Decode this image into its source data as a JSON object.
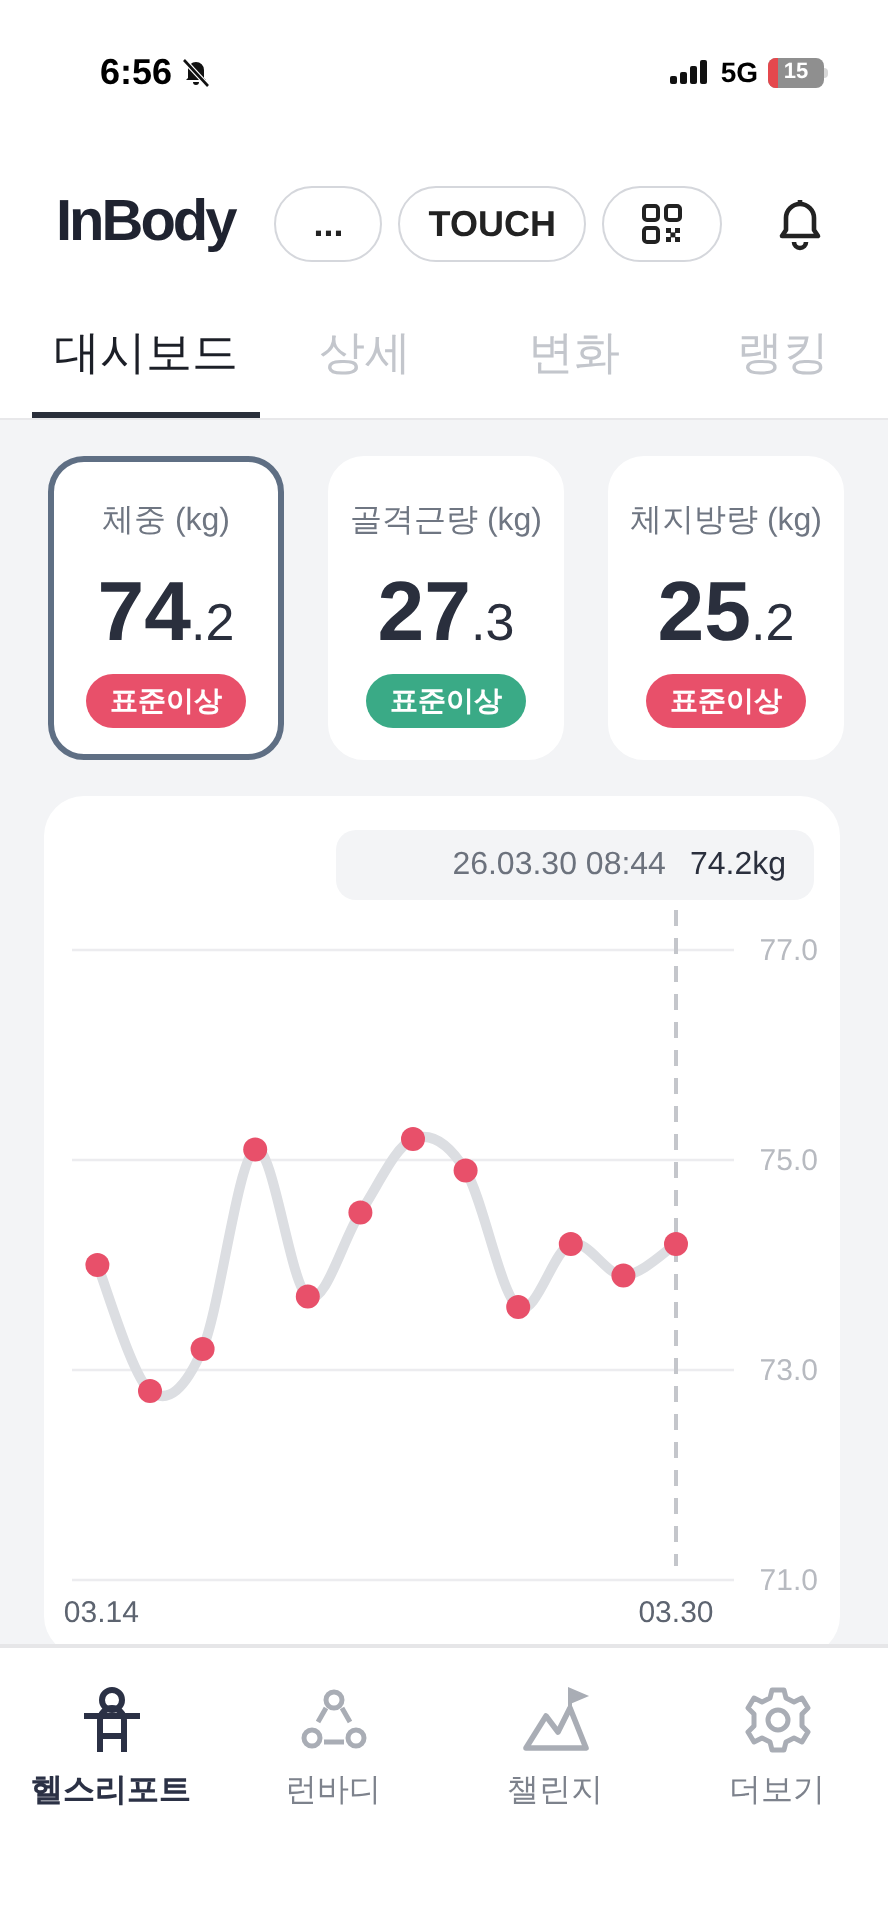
{
  "status_bar": {
    "time": "6:56",
    "network": "5G",
    "battery": "15"
  },
  "header": {
    "logo": "InBody",
    "buttons": [
      {
        "kind": "text",
        "label": "..."
      },
      {
        "kind": "text",
        "label": "TOUCH"
      },
      {
        "kind": "qr"
      }
    ]
  },
  "tabs": [
    {
      "label": "대시보드",
      "selected": true
    },
    {
      "label": "상세",
      "selected": false
    },
    {
      "label": "변화",
      "selected": false
    },
    {
      "label": "랭킹",
      "selected": false
    }
  ],
  "metrics": [
    {
      "title": "체중 (kg)",
      "whole": "74",
      "decimal": ".2",
      "badge": "표준이상",
      "color": "#e8506a",
      "selected": true
    },
    {
      "title": "골격근량 (kg)",
      "whole": "27",
      "decimal": ".3",
      "badge": "표준이상",
      "color": "#3aaa86",
      "selected": false
    },
    {
      "title": "체지방량 (kg)",
      "whole": "25",
      "decimal": ".2",
      "badge": "표준이상",
      "color": "#e8506a",
      "selected": false
    }
  ],
  "chart": {
    "tooltip": {
      "date": "26.03.30 08:44",
      "value": "74.2kg"
    },
    "chart_data": {
      "type": "line",
      "categories": [
        "03.14",
        null,
        null,
        null,
        null,
        null,
        null,
        null,
        null,
        null,
        null,
        "03.30"
      ],
      "series": [
        {
          "color": "#e8506a",
          "marker": "circle",
          "values": [
            74.0,
            72.8,
            73.2,
            75.1,
            73.7,
            74.5,
            75.2,
            74.9,
            73.6,
            74.2,
            73.9,
            74.2
          ]
        }
      ],
      "ylim": [
        71,
        77
      ],
      "yticks": [
        {
          "value": 77,
          "label": "77.0"
        },
        {
          "value": 75,
          "label": "75.0"
        },
        {
          "value": 73,
          "label": "73.0"
        },
        {
          "value": 71,
          "label": "71.0"
        }
      ]
    }
  },
  "bottom_nav": [
    {
      "kind": "report",
      "label": "헬스리포트",
      "selected": true
    },
    {
      "kind": "run",
      "label": "런바디",
      "selected": false
    },
    {
      "kind": "challenge",
      "label": "챌린지",
      "selected": false
    },
    {
      "kind": "more",
      "label": "더보기",
      "selected": false
    }
  ]
}
